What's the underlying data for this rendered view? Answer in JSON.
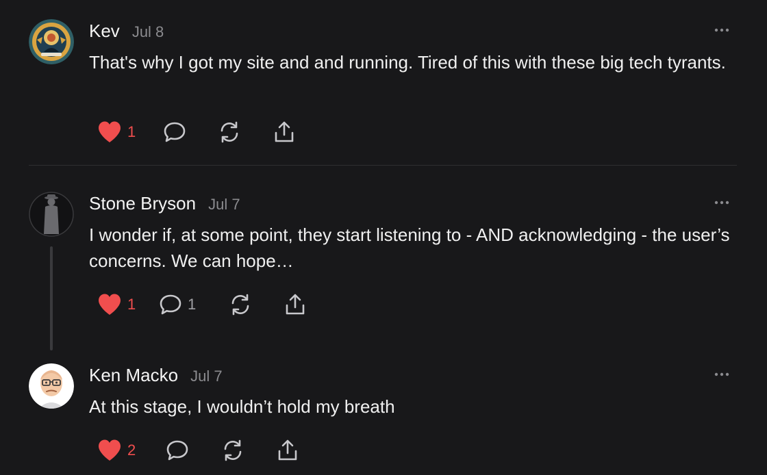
{
  "comments": [
    {
      "author": "Kev",
      "date": "Jul 8",
      "body": "That's why I got my site and and running. Tired of this with these big tech tyrants.",
      "likes": "1",
      "replies": "",
      "liked": true,
      "avatar_icon": "ornate-emblem-avatar-icon"
    },
    {
      "author": "Stone Bryson",
      "date": "Jul 7",
      "body": "I wonder if, at some point, they start listening to - AND acknowledging - the user’s concerns. We can hope…",
      "likes": "1",
      "replies": "1",
      "liked": true,
      "avatar_icon": "silhouette-avatar-icon"
    },
    {
      "author": "Ken Macko",
      "date": "Jul 7",
      "body": "At this stage, I wouldn’t hold my breath",
      "likes": "2",
      "replies": "",
      "liked": true,
      "avatar_icon": "cartoon-face-avatar-icon"
    }
  ],
  "icons": {
    "more": "more-dots-icon",
    "like": "heart-icon",
    "reply": "comment-bubble-icon",
    "restack": "restack-arrows-icon",
    "share": "share-upload-icon"
  },
  "colors": {
    "background": "#18181a",
    "text": "#f0f0f0",
    "muted": "#8b8b8f",
    "like": "#f04e4e",
    "icon": "#c8c8cc"
  }
}
